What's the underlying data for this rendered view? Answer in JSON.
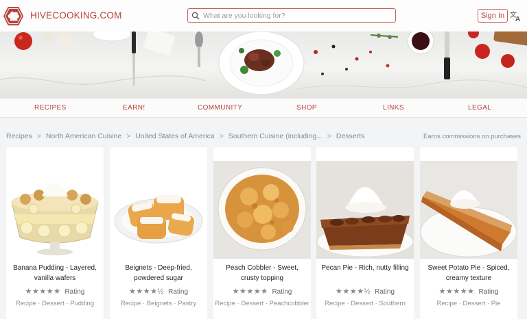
{
  "header": {
    "brand": "HIVECOOKING.COM",
    "search_placeholder": "What are you looking for?",
    "signin_label": "Sign In"
  },
  "nav": {
    "items": [
      "RECIPES",
      "EARN!",
      "COMMUNITY",
      "SHOP",
      "LINKS",
      "LEGAL"
    ]
  },
  "breadcrumb": {
    "items": [
      "Recipes",
      "North American Cuisine",
      "United States of America",
      "Southern Cuisine (including...",
      "Desserts"
    ],
    "separator": ">"
  },
  "commission_note": "Earns commissions on purchases",
  "cards": [
    {
      "title": "Banana Pudding - Layered, vanilla wafers",
      "stars": "★★★★★",
      "rating_label": "Rating",
      "tags": "Recipe · Dessert · Pudding"
    },
    {
      "title": "Beignets - Deep-fried, powdered sugar",
      "stars": "★★★★½",
      "rating_label": "Rating",
      "tags": "Recipe · Beignets · Pastry"
    },
    {
      "title": "Peach Cobbler - Sweet, crusty topping",
      "stars": "★★★★★",
      "rating_label": "Rating",
      "tags": "Recipe · Dessert · Peachcobbler"
    },
    {
      "title": "Pecan Pie - Rich, nutty filling",
      "stars": "★★★★½",
      "rating_label": "Rating",
      "tags": "Recipe · Dessert · Southern"
    },
    {
      "title": "Sweet Potato Pie - Spiced, creamy texture",
      "stars": "★★★★★",
      "rating_label": "Rating",
      "tags": "Recipe · Dessert · Pie"
    }
  ],
  "colors": {
    "brand": "#b8413b",
    "background": "#f3f4f5",
    "card": "#ffffff"
  },
  "icons": [
    "chef-hat-logo-icon",
    "search-icon",
    "translate-icon",
    "star-icon"
  ]
}
